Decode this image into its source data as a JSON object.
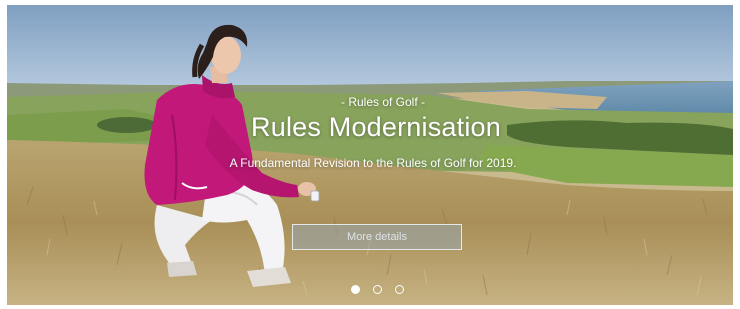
{
  "hero": {
    "kicker": "- Rules of Golf -",
    "title": "Rules Modernisation",
    "subtitle": "A Fundamental Revision to the Rules of Golf for 2019.",
    "button_label": "More details"
  },
  "carousel": {
    "slide_count": 3,
    "active_index": 0
  },
  "colors": {
    "jacket": "#c2187a",
    "sky": "#8fb0cf",
    "sea": "#6d97b5",
    "grass": "#b7a06a",
    "fairway": "#7aa24e"
  }
}
